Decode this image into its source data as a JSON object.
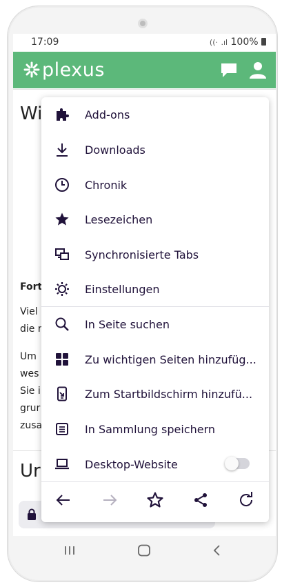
{
  "status": {
    "time": "17:09",
    "battery": "100%"
  },
  "app": {
    "logo_text": "plexus",
    "accent": "#5cb87a"
  },
  "page": {
    "heading_fragment": "Wi",
    "bold_fragment": "Fort",
    "lines": [
      "Viel",
      "die r",
      "Um",
      "wes",
      "Sie i",
      "grur",
      "zusa"
    ],
    "heading2_fragment": "Ur"
  },
  "menu": {
    "items": [
      {
        "label": "Add-ons",
        "icon": "puzzle-icon"
      },
      {
        "label": "Downloads",
        "icon": "download-icon"
      },
      {
        "label": "Chronik",
        "icon": "clock-icon"
      },
      {
        "label": "Lesezeichen",
        "icon": "star-filled-icon"
      },
      {
        "label": "Synchronisierte Tabs",
        "icon": "synced-tabs-icon"
      },
      {
        "label": "Einstellungen",
        "icon": "gear-icon"
      },
      {
        "label": "In Seite suchen",
        "icon": "search-icon"
      },
      {
        "label": "Zu wichtigen Seiten hinzufüg...",
        "icon": "grid-icon"
      },
      {
        "label": "Zum Startbildschirm hinzufü...",
        "icon": "add-to-homescreen-icon"
      },
      {
        "label": "In Sammlung speichern",
        "icon": "collection-icon"
      },
      {
        "label": "Desktop-Website",
        "icon": "laptop-icon",
        "toggle": false
      }
    ]
  }
}
